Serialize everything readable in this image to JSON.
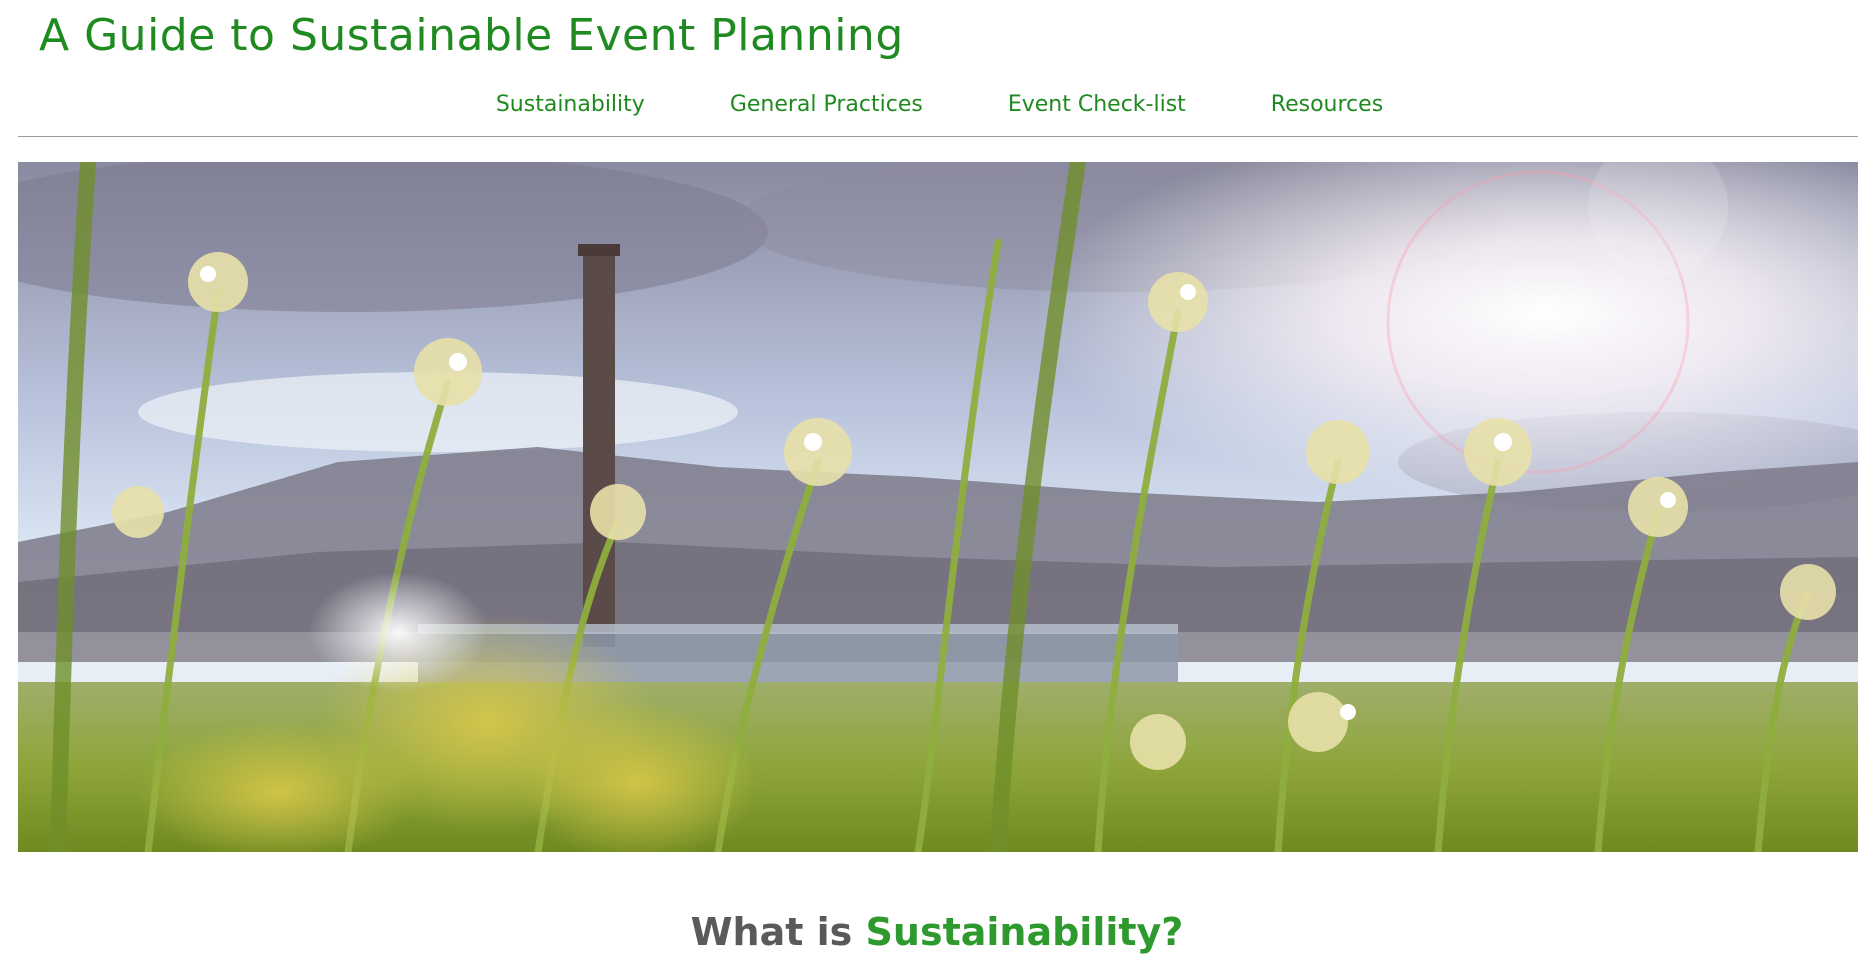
{
  "header": {
    "title": "A Guide to Sustainable Event Planning"
  },
  "nav": {
    "items": [
      {
        "label": "Sustainability"
      },
      {
        "label": "General Practices"
      },
      {
        "label": "Event Check-list"
      },
      {
        "label": "Resources"
      }
    ]
  },
  "hero": {
    "image_subject": "wildflowers-field-with-factory-chimney"
  },
  "section": {
    "heading_plain": "What is ",
    "heading_accent": "Sustainability?"
  },
  "colors": {
    "brand_green": "#1f8a1f",
    "accent_green": "#2e9a2e",
    "heading_gray": "#5a5a5a",
    "divider_gray": "#9a9a9a"
  }
}
